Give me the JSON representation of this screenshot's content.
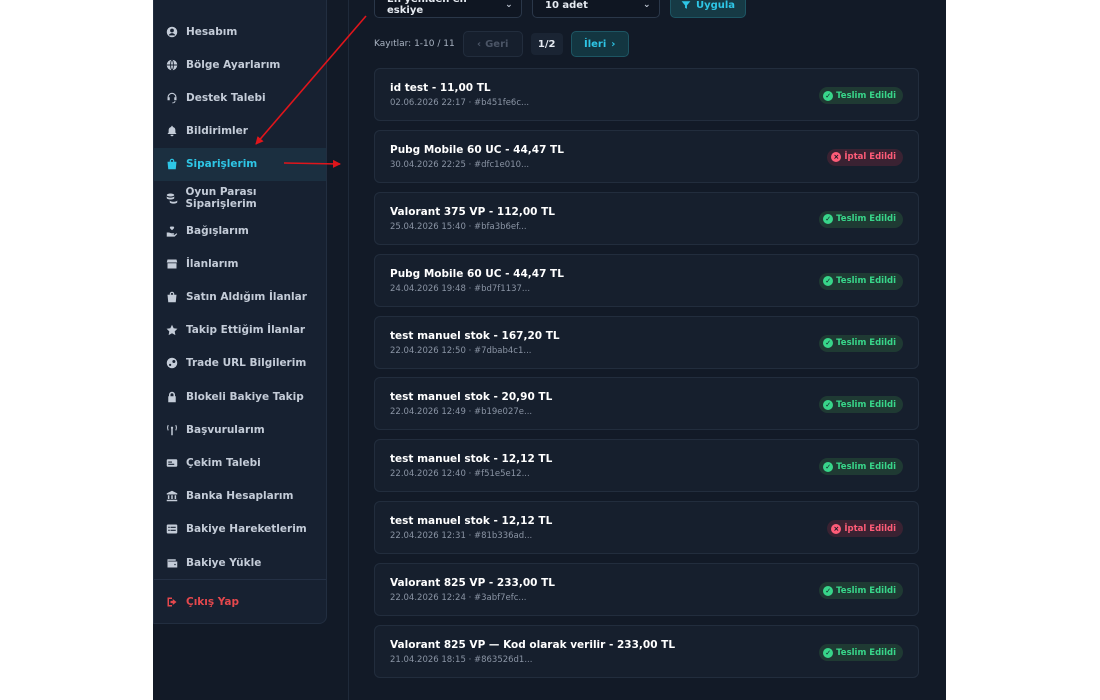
{
  "sidebar": {
    "items": [
      {
        "label": "Hesabım",
        "icon": "user-circle-icon"
      },
      {
        "label": "Bölge Ayarlarım",
        "icon": "globe-icon"
      },
      {
        "label": "Destek Talebi",
        "icon": "headset-icon"
      },
      {
        "label": "Bildirimler",
        "icon": "bell-icon"
      },
      {
        "label": "Siparişlerim",
        "icon": "shopping-bag-icon",
        "active": true
      },
      {
        "label": "Oyun Parası Siparişlerim",
        "icon": "coins-icon"
      },
      {
        "label": "Bağışlarım",
        "icon": "hand-holding-heart-icon"
      },
      {
        "label": "İlanlarım",
        "icon": "store-icon"
      },
      {
        "label": "Satın Aldığım İlanlar",
        "icon": "shopping-bag-icon"
      },
      {
        "label": "Takip Ettiğim İlanlar",
        "icon": "star-icon"
      },
      {
        "label": "Trade URL Bilgilerim",
        "icon": "steam-icon"
      },
      {
        "label": "Blokeli Bakiye Takip",
        "icon": "lock-icon"
      },
      {
        "label": "Başvurularım",
        "icon": "broadcast-icon"
      },
      {
        "label": "Çekim Talebi",
        "icon": "money-bill-icon"
      },
      {
        "label": "Banka Hesaplarım",
        "icon": "bank-icon"
      },
      {
        "label": "Bakiye Hareketlerim",
        "icon": "list-icon"
      },
      {
        "label": "Bakiye Yükle",
        "icon": "wallet-icon"
      }
    ],
    "logout_label": "Çıkış Yap"
  },
  "filters": {
    "sort_value": "En yeniden en eskiye",
    "count_value": "10 adet",
    "apply_label": "Uygula"
  },
  "pager": {
    "records": "Kayıtlar: 1-10 / 11",
    "prev_label": "Geri",
    "page": "1/2",
    "next_label": "İleri"
  },
  "orders": [
    {
      "title": "id test - 11,00 TL",
      "meta": "02.06.2026 22:17 · #b451fe6c...",
      "status": "Teslim Edildi",
      "status_type": "ok"
    },
    {
      "title": "Pubg Mobile 60 UC - 44,47 TL",
      "meta": "30.04.2026 22:25 · #dfc1e010...",
      "status": "İptal Edildi",
      "status_type": "cancel"
    },
    {
      "title": "Valorant 375 VP - 112,00 TL",
      "meta": "25.04.2026 15:40 · #bfa3b6ef...",
      "status": "Teslim Edildi",
      "status_type": "ok"
    },
    {
      "title": "Pubg Mobile 60 UC - 44,47 TL",
      "meta": "24.04.2026 19:48 · #bd7f1137...",
      "status": "Teslim Edildi",
      "status_type": "ok"
    },
    {
      "title": "test manuel stok - 167,20 TL",
      "meta": "22.04.2026 12:50 · #7dbab4c1...",
      "status": "Teslim Edildi",
      "status_type": "ok"
    },
    {
      "title": "test manuel stok - 20,90 TL",
      "meta": "22.04.2026 12:49 · #b19e027e...",
      "status": "Teslim Edildi",
      "status_type": "ok"
    },
    {
      "title": "test manuel stok - 12,12 TL",
      "meta": "22.04.2026 12:40 · #f51e5e12...",
      "status": "Teslim Edildi",
      "status_type": "ok"
    },
    {
      "title": "test manuel stok - 12,12 TL",
      "meta": "22.04.2026 12:31 · #81b336ad...",
      "status": "İptal Edildi",
      "status_type": "cancel"
    },
    {
      "title": "Valorant 825 VP - 233,00 TL",
      "meta": "22.04.2026 12:24 · #3abf7efc...",
      "status": "Teslim Edildi",
      "status_type": "ok"
    },
    {
      "title": "Valorant 825 VP — Kod olarak verilir - 233,00 TL",
      "meta": "21.04.2026 18:15 · #863526d1...",
      "status": "Teslim Edildi",
      "status_type": "ok"
    }
  ],
  "colors": {
    "accent": "#2ec6e6",
    "success": "#38d68a",
    "danger": "#ff5c78",
    "annotation_arrow": "#e0151b"
  }
}
